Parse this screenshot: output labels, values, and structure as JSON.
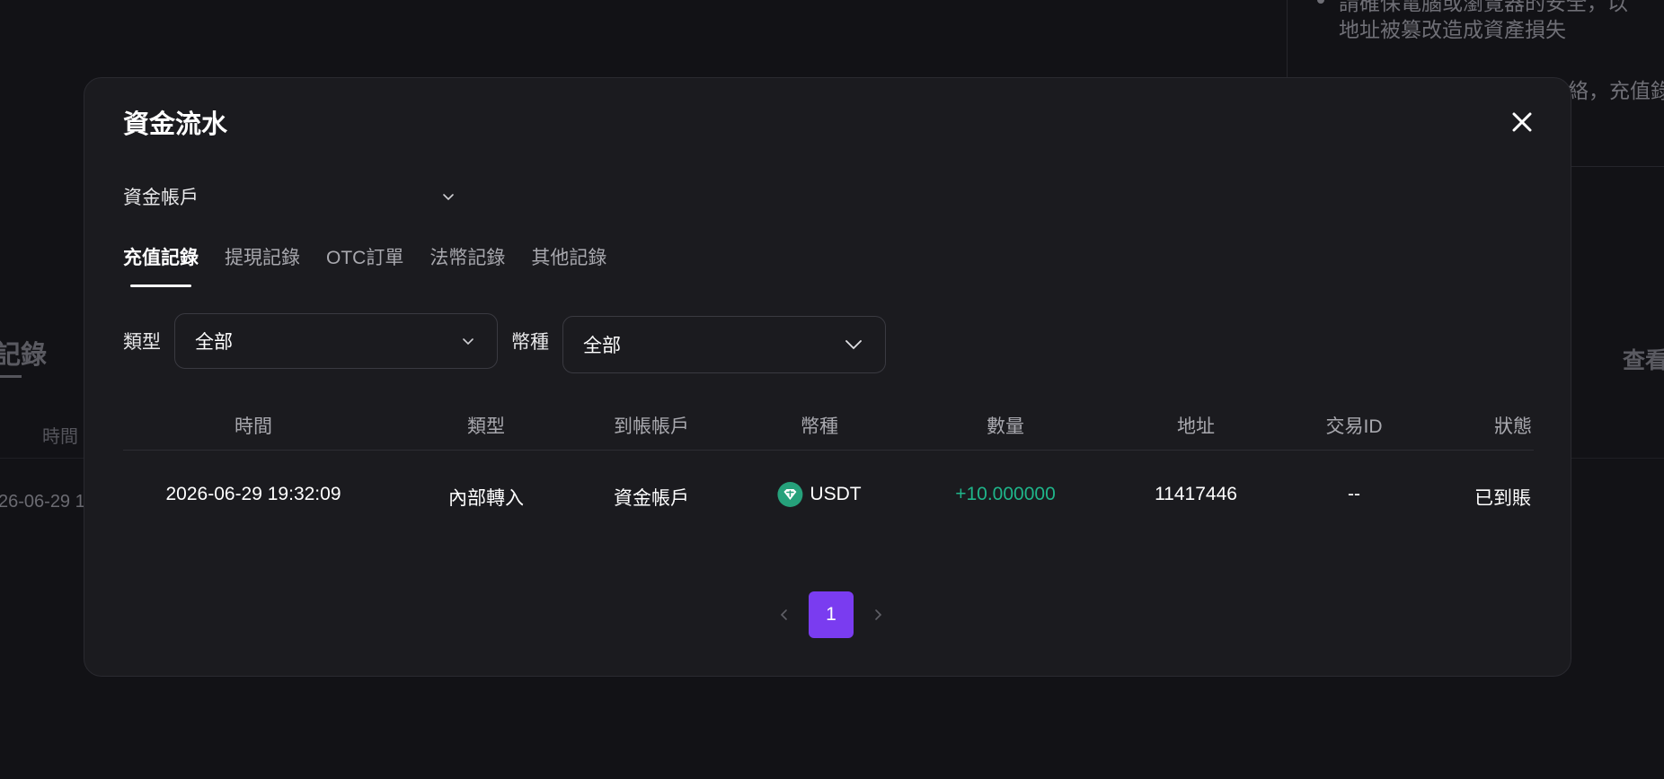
{
  "background": {
    "note_line1": "請確保電腦或瀏覽器的安全，以",
    "note_line2": "地址被篡改造成資產損失",
    "note_line3": "絡，充值錄",
    "section_title": "記錄",
    "view_more": "查看",
    "col_time": "時間",
    "row_time": "26-06-29 1",
    "footer_col1": "",
    "footer_col2": "",
    "footer_col3": "",
    "footer_col4": "",
    "footer_col5": ""
  },
  "modal": {
    "title": "資金流水",
    "close_icon": "close-icon",
    "account_select": {
      "value": "資金帳戶",
      "icon": "chevron-down-icon"
    },
    "tabs": [
      {
        "label": "充值記錄",
        "active": true
      },
      {
        "label": "提現記錄",
        "active": false
      },
      {
        "label": "OTC訂單",
        "active": false
      },
      {
        "label": "法幣記錄",
        "active": false
      },
      {
        "label": "其他記錄",
        "active": false
      }
    ],
    "filters": {
      "type_label": "類型",
      "type_value": "全部",
      "currency_label": "幣種",
      "currency_value": "全部"
    },
    "table": {
      "headers": [
        "時間",
        "類型",
        "到帳帳戶",
        "幣種",
        "數量",
        "地址",
        "交易ID",
        "狀態"
      ],
      "rows": [
        {
          "time": "2026-06-29 19:32:09",
          "type": "內部轉入",
          "account": "資金帳戶",
          "currency": "USDT",
          "currency_icon": "usdt-icon",
          "amount": "+10.000000",
          "address": "11417446",
          "txid": "--",
          "status": "已到賬"
        }
      ]
    },
    "pagination": {
      "current": "1",
      "prev_icon": "chevron-left-icon",
      "next_icon": "chevron-right-icon"
    },
    "colors": {
      "accent": "#7a3cf0",
      "positive": "#1fb58a",
      "usdt": "#26a17b"
    }
  }
}
